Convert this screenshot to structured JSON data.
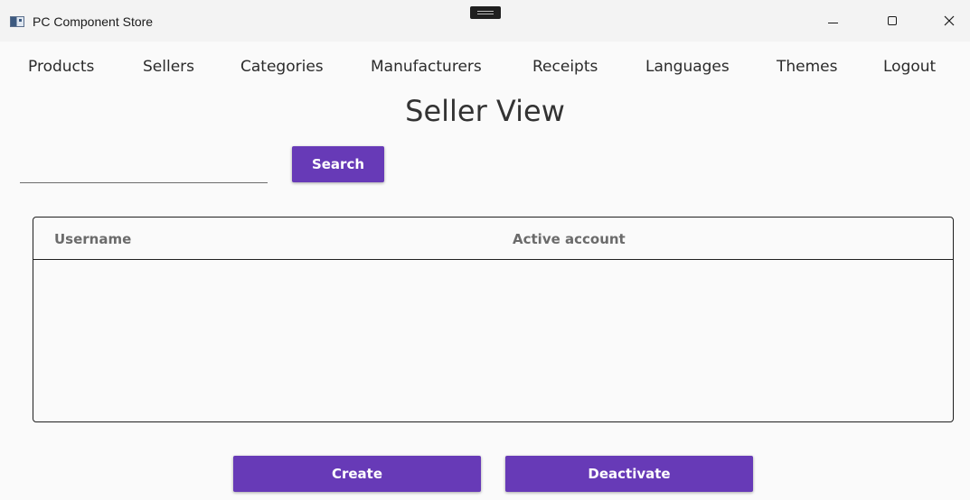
{
  "window": {
    "title": "PC Component Store"
  },
  "menu": {
    "items": [
      {
        "label": "Products"
      },
      {
        "label": "Sellers"
      },
      {
        "label": "Categories"
      },
      {
        "label": "Manufacturers"
      },
      {
        "label": "Receipts"
      },
      {
        "label": "Languages"
      },
      {
        "label": "Themes"
      },
      {
        "label": "Logout"
      }
    ]
  },
  "page": {
    "title": "Seller View"
  },
  "search": {
    "value": "",
    "placeholder": "",
    "button_label": "Search"
  },
  "table": {
    "columns": [
      "Username",
      "Active account"
    ],
    "rows": []
  },
  "actions": {
    "create_label": "Create",
    "deactivate_label": "Deactivate"
  },
  "colors": {
    "accent": "#673ab7",
    "background": "#fafafa",
    "titlebar": "#f3f3f3"
  },
  "icons": {
    "app": "app-window-icon",
    "minimize": "minimize-icon",
    "maximize": "maximize-icon",
    "close": "close-icon"
  }
}
